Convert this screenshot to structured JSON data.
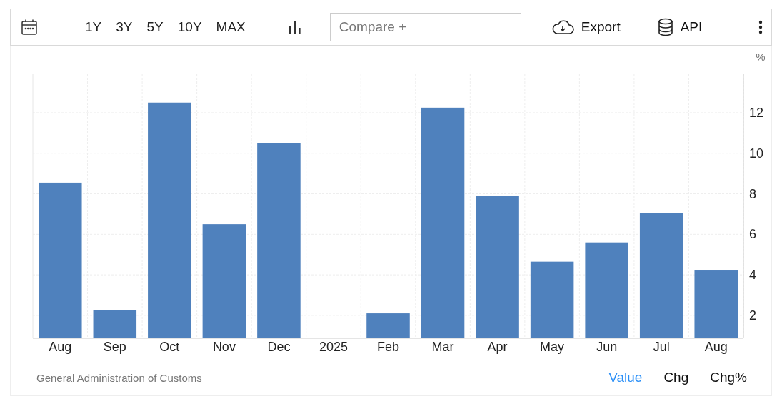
{
  "toolbar": {
    "ranges": [
      {
        "label": "1Y",
        "selected": false
      },
      {
        "label": "3Y",
        "selected": false
      },
      {
        "label": "5Y",
        "selected": false
      },
      {
        "label": "10Y",
        "selected": false
      },
      {
        "label": "MAX",
        "selected": false
      }
    ],
    "compare": {
      "placeholder": "Compare +"
    },
    "export": "Export",
    "api": "API"
  },
  "chart": {
    "unit": "%",
    "chart_data": {
      "type": "bar",
      "categories": [
        "Aug",
        "Sep",
        "Oct",
        "Nov",
        "Dec",
        "2025",
        "Feb",
        "Mar",
        "Apr",
        "May",
        "Jun",
        "Jul",
        "Aug"
      ],
      "grid": true,
      "series": [
        {
          "color": "#4f81bd",
          "values": [
            8.55,
            2.25,
            12.5,
            6.5,
            10.5,
            null,
            2.1,
            12.25,
            7.9,
            4.65,
            5.6,
            7.05,
            4.25
          ]
        }
      ],
      "ylim": [
        0.87,
        13.9
      ],
      "yticks": [
        2,
        4,
        6,
        8,
        10,
        12
      ]
    }
  },
  "source": "General Administration of Customs",
  "views": [
    {
      "label": "Value",
      "selected": true
    },
    {
      "label": "Chg",
      "selected": false
    },
    {
      "label": "Chg%",
      "selected": false
    }
  ]
}
